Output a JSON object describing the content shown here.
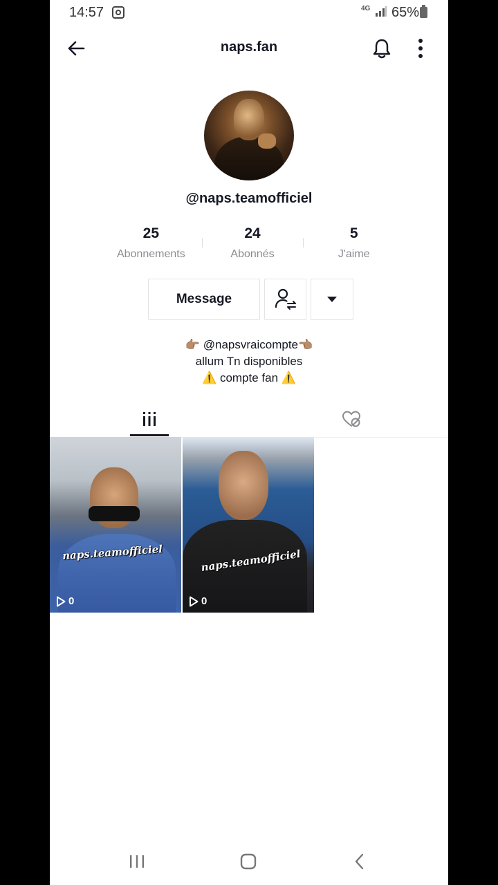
{
  "status_bar": {
    "time": "14:57",
    "network": "4G",
    "battery": "65%",
    "icons": [
      "instagram-icon",
      "signal-icon",
      "battery-icon"
    ]
  },
  "header": {
    "title": "naps.fan",
    "icons": [
      "back-arrow-icon",
      "bell-icon",
      "more-vertical-icon"
    ]
  },
  "profile": {
    "handle": "@naps.teamofficiel",
    "stats": [
      {
        "value": "25",
        "label": "Abonnements"
      },
      {
        "value": "24",
        "label": "Abonnés"
      },
      {
        "value": "5",
        "label": "J'aime"
      }
    ],
    "message_label": "Message",
    "bio": {
      "line1_emoji_left": "👉🏽",
      "line1_text": "@napsvraicompte",
      "line1_emoji_right": "👈🏽",
      "line2": "allum Tn disponibles",
      "line3_emoji": "⚠️",
      "line3_text": "compte fan"
    }
  },
  "tabs": {
    "icons": [
      "videos-grid-icon",
      "liked-heart-hidden-icon"
    ],
    "active": 0
  },
  "videos": [
    {
      "watermark": "naps.teamofficiel",
      "plays": "0"
    },
    {
      "watermark": "naps.teamofficiel",
      "plays": "0"
    }
  ],
  "colors": {
    "text": "#161823",
    "muted": "#8a8b91",
    "border": "#e3e3e4"
  }
}
